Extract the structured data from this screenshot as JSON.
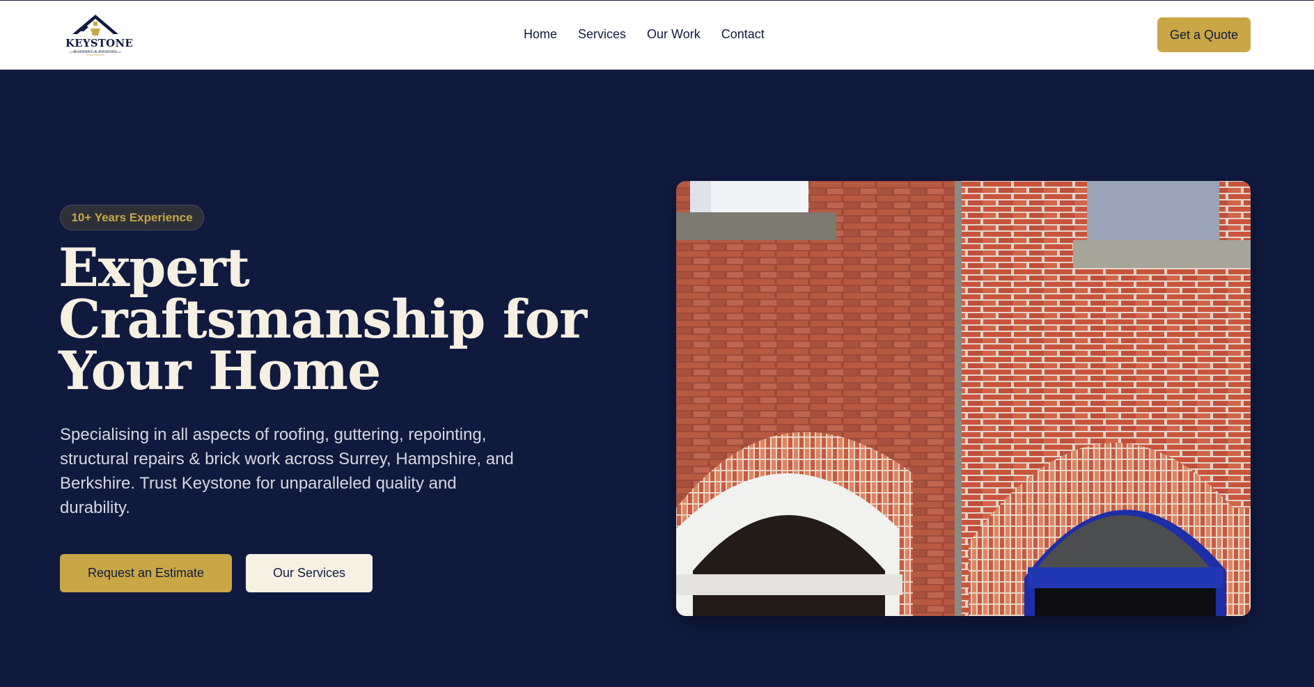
{
  "brand": {
    "name": "KEYSTONE",
    "tagline": "MASONRY & ROOFING",
    "logo_icon": "house-roof-logo-icon"
  },
  "nav": {
    "items": [
      {
        "label": "Home"
      },
      {
        "label": "Services"
      },
      {
        "label": "Our Work"
      },
      {
        "label": "Contact"
      }
    ]
  },
  "header": {
    "cta_label": "Get a Quote"
  },
  "hero": {
    "badge": "10+ Years Experience",
    "headline": "Expert Craftsmanship for Your Home",
    "description": "Specialising in all aspects of roofing, guttering, repointing, structural repairs & brick work across Surrey, Hampshire, and Berkshire. Trust Keystone for unparalleled quality and durability.",
    "primary_cta": "Request an Estimate",
    "secondary_cta": "Our Services",
    "image": "brick-wall-arched-windows-photo"
  },
  "colors": {
    "navy": "#101a3f",
    "gold": "#c9a746",
    "cream": "#f7f1e4",
    "brick": "#b9573f"
  }
}
